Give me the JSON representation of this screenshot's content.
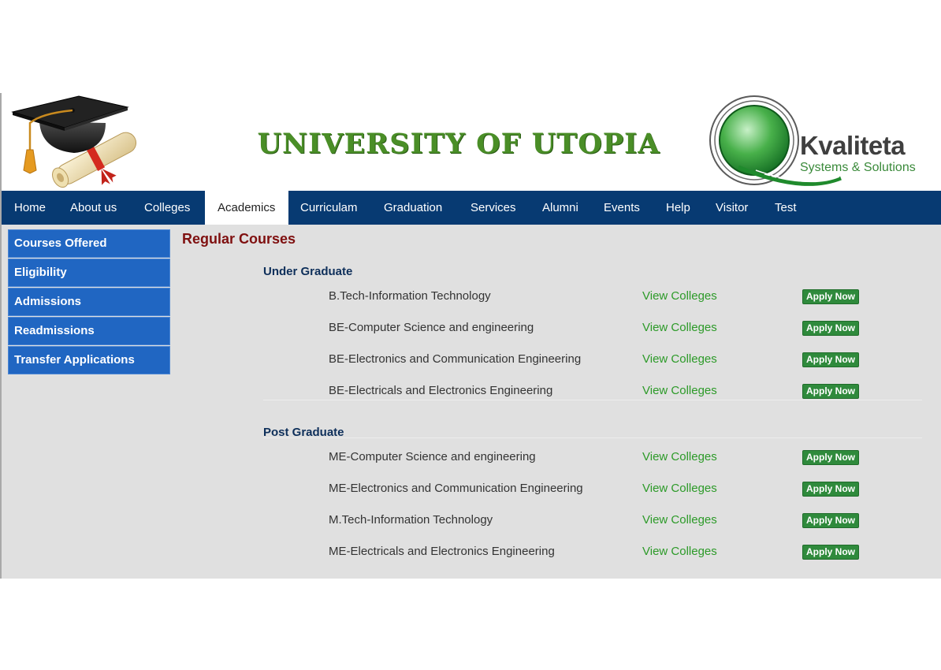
{
  "header": {
    "title": "UNIVERSITY OF UTOPIA",
    "sponsor_name": "Kvaliteta",
    "sponsor_tagline": "Systems & Solutions"
  },
  "nav": {
    "items": [
      "Home",
      "About us",
      "Colleges",
      "Academics",
      "Curriculam",
      "Graduation",
      "Services",
      "Alumni",
      "Events",
      "Help",
      "Visitor",
      "Test"
    ],
    "active": "Academics"
  },
  "sidebar": {
    "items": [
      "Courses Offered",
      "Eligibility",
      "Admissions",
      "Readmissions",
      "Transfer Applications"
    ]
  },
  "main": {
    "title": "Regular Courses",
    "view_label": "View Colleges",
    "apply_label": "Apply Now",
    "sections": [
      {
        "title": "Under Graduate",
        "courses": [
          "B.Tech-Information Technology",
          "BE-Computer Science and engineering",
          "BE-Electronics and Communication Engineering",
          "BE-Electricals and Electronics Engineering"
        ]
      },
      {
        "title": "Post Graduate",
        "courses": [
          "ME-Computer Science and engineering",
          "ME-Electronics and Communication Engineering",
          "M.Tech-Information Technology",
          "ME-Electricals and Electronics Engineering"
        ]
      }
    ]
  },
  "colors": {
    "nav_bg": "#073a72",
    "sidebar_bg": "#2066c2",
    "title_green": "#4a8e27",
    "link_green": "#2c9a28",
    "apply_green": "#2f8a3c",
    "heading_red": "#7f1010",
    "section_blue": "#0e2f5a",
    "content_bg": "#e0e0e0"
  },
  "icons": {
    "left_logo": "graduation-cap-diploma-icon",
    "right_logo": "kvaliteta-q-logo-icon"
  }
}
